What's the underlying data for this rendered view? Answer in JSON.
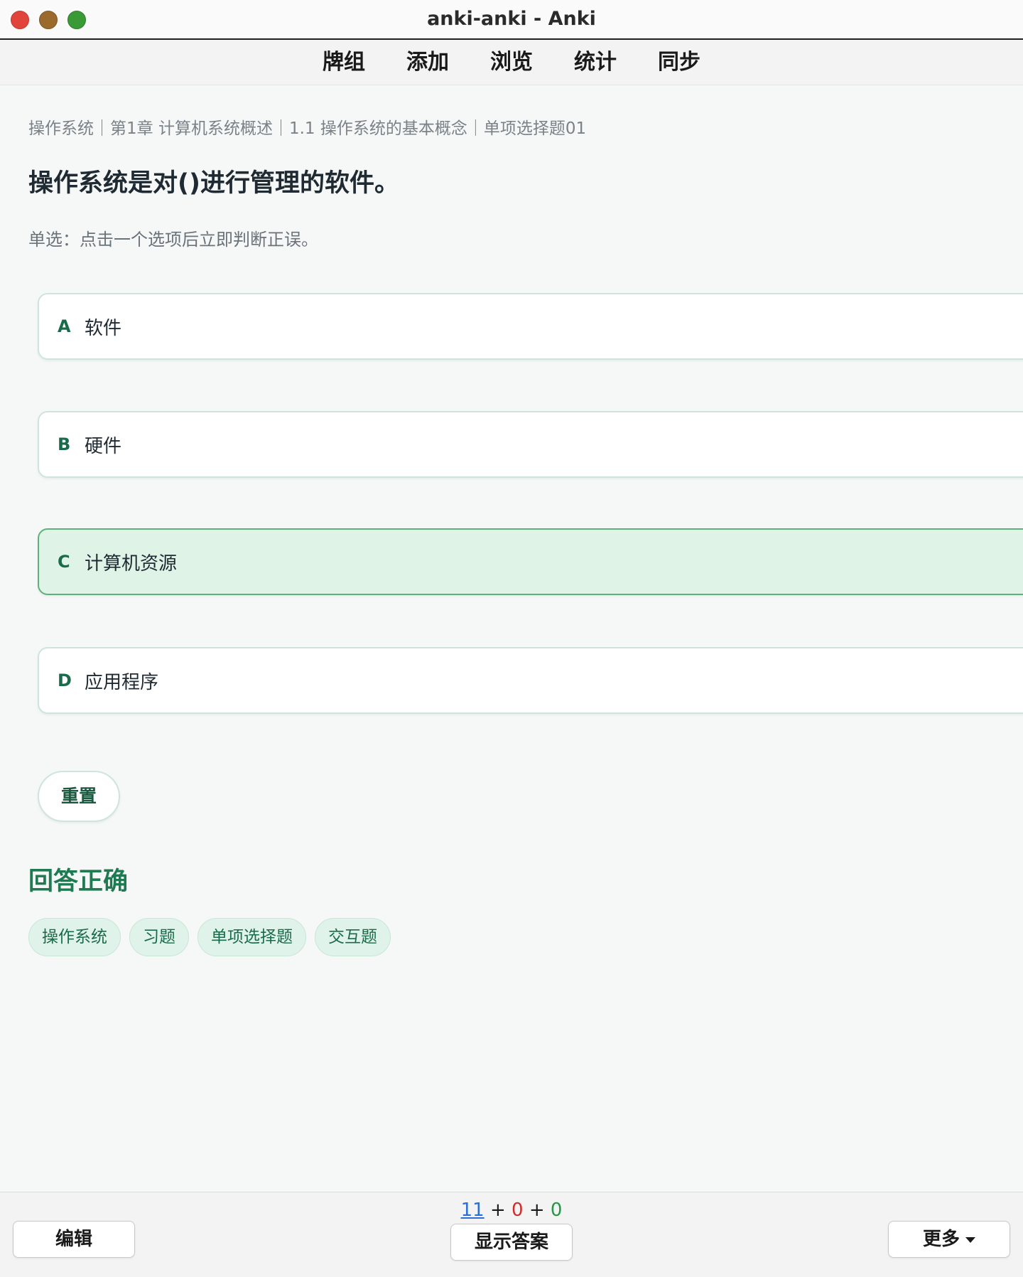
{
  "window": {
    "title": "anki-anki - Anki"
  },
  "toolbar": {
    "items": [
      "牌组",
      "添加",
      "浏览",
      "统计",
      "同步"
    ]
  },
  "card": {
    "breadcrumb": "操作系统｜第1章 计算机系统概述｜1.1 操作系统的基本概念｜单项选择题01",
    "question": "操作系统是对()进行管理的软件。",
    "hint": "单选：点击一个选项后立即判断正误。",
    "options": [
      {
        "letter": "A",
        "text": "软件"
      },
      {
        "letter": "B",
        "text": "硬件"
      },
      {
        "letter": "C",
        "text": "计算机资源",
        "selected": true
      },
      {
        "letter": "D",
        "text": "应用程序"
      }
    ],
    "reset_label": "重置",
    "result": "回答正确",
    "tags": [
      "操作系统",
      "习题",
      "单项选择题",
      "交互题"
    ]
  },
  "bottombar": {
    "counts": {
      "new": "11",
      "learn": "0",
      "review": "0",
      "plus": "+"
    },
    "edit_label": "编辑",
    "show_answer_label": "显示答案",
    "more_label": "更多"
  },
  "colors": {
    "accent": "#1f7a52",
    "selected_bg": "#dff3e6",
    "count_new": "#2b6fd6",
    "count_learn": "#d22b2b",
    "count_review": "#1f9a43"
  }
}
